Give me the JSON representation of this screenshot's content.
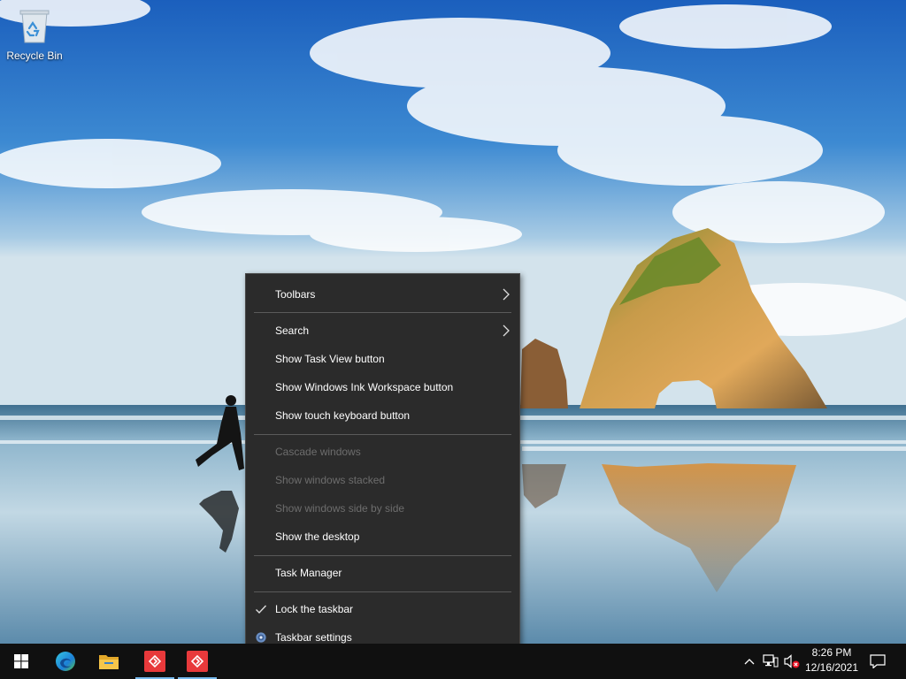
{
  "desktop": {
    "icons": [
      {
        "label": "Recycle Bin",
        "icon": "recycle-bin-icon"
      }
    ]
  },
  "context_menu": {
    "items": [
      {
        "label": "Toolbars",
        "submenu": true
      },
      {
        "label": "Search",
        "submenu": true
      },
      {
        "label": "Show Task View button"
      },
      {
        "label": "Show Windows Ink Workspace button"
      },
      {
        "label": "Show touch keyboard button"
      },
      {
        "label": "Cascade windows",
        "disabled": true
      },
      {
        "label": "Show windows stacked",
        "disabled": true
      },
      {
        "label": "Show windows side by side",
        "disabled": true
      },
      {
        "label": "Show the desktop"
      },
      {
        "label": "Task Manager"
      },
      {
        "label": "Lock the taskbar",
        "checked": true,
        "icon": "check-icon"
      },
      {
        "label": "Taskbar settings",
        "icon": "gear-icon"
      }
    ]
  },
  "taskbar": {
    "apps": [
      {
        "name": "start",
        "icon": "windows-logo-icon"
      },
      {
        "name": "edge",
        "icon": "edge-icon"
      },
      {
        "name": "file-explorer",
        "icon": "folder-icon"
      },
      {
        "name": "app-1",
        "icon": "red-app-icon",
        "active": true
      },
      {
        "name": "app-2",
        "icon": "red-app-icon",
        "active": true
      }
    ],
    "tray": {
      "icons": [
        "chevron-up-icon",
        "network-icon",
        "volume-muted-icon"
      ],
      "time": "8:26 PM",
      "date": "12/16/2021",
      "notification_icon": "notification-icon"
    }
  },
  "colors": {
    "menu_bg": "#2b2b2b",
    "menu_separator": "#5a5a5a",
    "menu_disabled_text": "#6d6d6d",
    "taskbar_bg": "#101010",
    "active_indicator": "#76b9ed",
    "app_red": "#e8393b"
  }
}
